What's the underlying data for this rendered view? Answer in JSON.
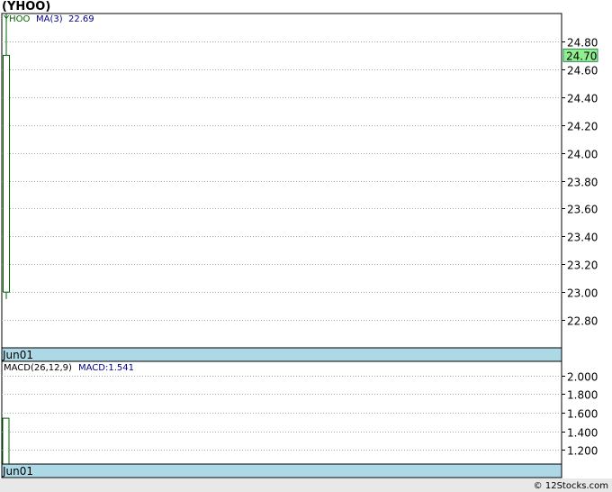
{
  "title": "(YHOO)",
  "footer": "© 12Stocks.com",
  "colors": {
    "frame": "#000000",
    "grid": "#aaaaaa",
    "date_band": "#add8e6",
    "candle": "#006400",
    "price_label_bg": "#90ee90",
    "legend_ticker": "#006400",
    "legend_ma": "#00008b",
    "legend_macd_name": "#000000",
    "legend_macd_value": "#00008b",
    "footer_bg": "#e8e8e8"
  },
  "price_panel": {
    "legend": {
      "ticker": "YHOO",
      "ma_label": "MA(3)",
      "ma_value": "22.69"
    },
    "date_label": "Jun01",
    "last_price_label": "24.70"
  },
  "macd_panel": {
    "legend": {
      "name": "MACD(26,12,9)",
      "value_text": "MACD:1.541"
    },
    "date_label": "Jun01"
  },
  "chart_data": [
    {
      "type": "candlestick",
      "title": "(YHOO)",
      "ylim": [
        22.6,
        25.0
      ],
      "yticks": [
        "24.80",
        "24.60",
        "24.40",
        "24.20",
        "24.00",
        "23.80",
        "23.60",
        "23.40",
        "23.20",
        "23.00",
        "22.80"
      ],
      "x": [
        "Jun01"
      ],
      "candles": [
        {
          "date": "Jun01",
          "open": 23.0,
          "close": 24.7,
          "high": 25.0,
          "low": 22.95
        }
      ],
      "last_price": 24.7,
      "series": [
        {
          "name": "MA(3)",
          "last_value": 22.69
        }
      ],
      "grid": true
    },
    {
      "type": "bar",
      "title": "MACD(26,12,9)",
      "ylim": [
        1.05,
        2.15
      ],
      "yticks": [
        "2.000",
        "1.800",
        "1.600",
        "1.400",
        "1.200"
      ],
      "x": [
        "Jun01"
      ],
      "series": [
        {
          "name": "MACD",
          "values": [
            1.541
          ]
        }
      ],
      "grid": true
    }
  ]
}
